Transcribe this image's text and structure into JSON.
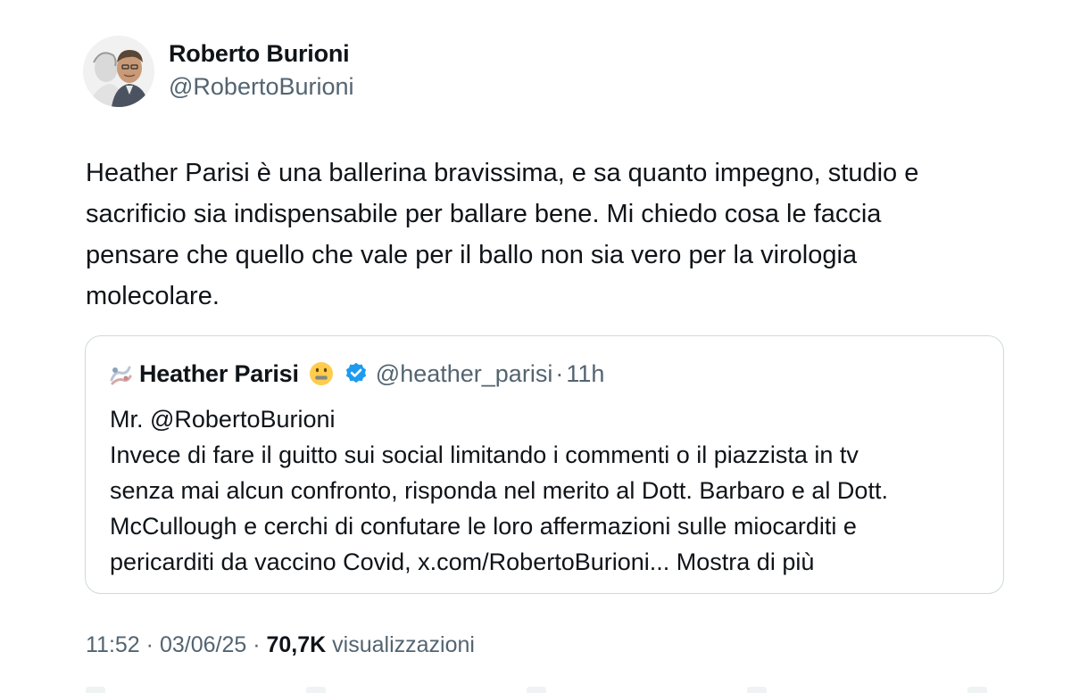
{
  "author": {
    "name": "Roberto Burioni",
    "handle": "@RobertoBurioni"
  },
  "tweet": {
    "text": "Heather Parisi è una ballerina bravissima, e sa quanto impegno, studio e\nsacrificio sia indispensabile per ballare bene.  Mi chiedo cosa le faccia\npensare che quello che vale per il ballo non sia vero per la virologia\nmolecolare."
  },
  "quote": {
    "name": "Heather Parisi",
    "handle": "@heather_parisi",
    "separator": "·",
    "time": "11h",
    "prefix_icon": "ballet-emoji-icon",
    "name_emoji": "zipper-mouth-face-icon",
    "verified_icon": "verified-badge-icon",
    "text": "Mr. @RobertoBurioni\nInvece di fare il guitto sui social limitando i commenti o il piazzista in tv\nsenza mai alcun confronto, risponda nel merito al Dott. Barbaro e al Dott.\nMcCullough e cerchi di confutare le loro affermazioni sulle miocarditi e\npericarditi da vaccino Covid, x.com/RobertoBurioni...",
    "show_more": " Mostra di più"
  },
  "meta": {
    "time": "11:52",
    "sep1": " · ",
    "date": "03/06/25",
    "sep2": " · ",
    "views_count": "70,7K",
    "views_label": " visualizzazioni"
  },
  "colors": {
    "text": "#0f1419",
    "secondary": "#536471",
    "border": "#cfd9de",
    "verified": "#1d9bf0"
  }
}
